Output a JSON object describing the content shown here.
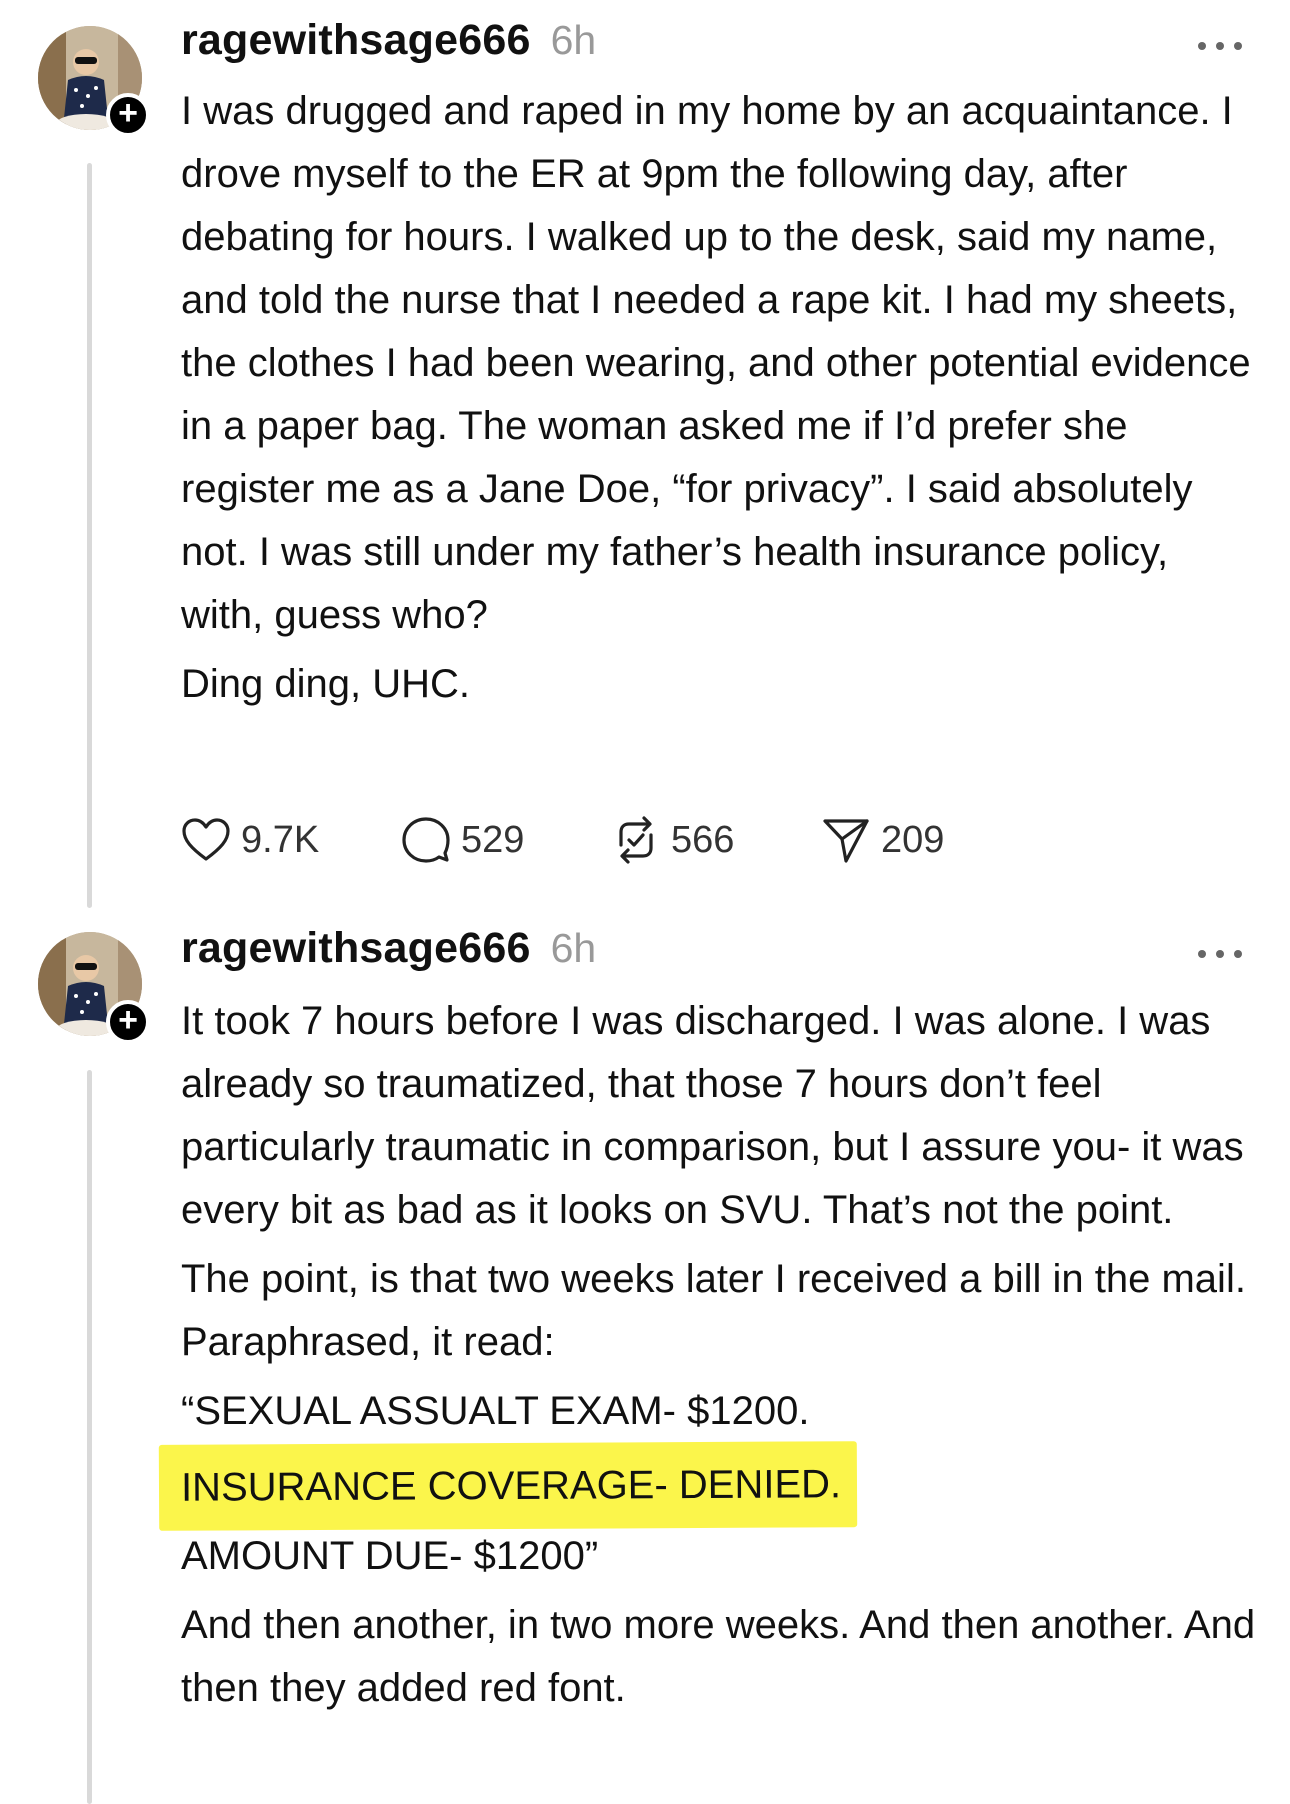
{
  "posts": [
    {
      "username": "ragewithsage666",
      "time": "6h",
      "paragraphs": [
        "I was drugged and raped in my home by an acquaintance. I drove myself to the ER at 9pm the following day, after debating for hours. I walked up to the desk, said my name, and told the nurse that I needed a rape kit. I had my sheets, the clothes I had been wearing, and other potential evidence in a paper bag. The woman asked me if I’d prefer she register me as a Jane Doe, “for privacy”. I said absolutely not. I was still under my father’s health insurance policy, with, guess who?",
        "Ding ding, UHC."
      ],
      "stats": {
        "likes": "9.7K",
        "replies": "529",
        "reposts": "566",
        "shares": "209"
      }
    },
    {
      "username": "ragewithsage666",
      "time": "6h",
      "paragraphs": [
        "It took 7 hours before I was discharged. I was alone. I was already so traumatized, that those 7 hours don’t feel particularly traumatic in comparison, but I assure you- it was every bit as bad as it looks on SVU. That’s not the point.",
        "The point, is that two weeks later I received a bill in the mail. Paraphrased, it read:",
        "“SEXUAL ASSUALT EXAM- $1200.",
        "INSURANCE COVERAGE- DENIED.",
        "AMOUNT DUE- $1200”",
        "And then another, in two more weeks. And then another. And then they added red font."
      ]
    }
  ],
  "icons": {
    "more": "more-horizontal-icon",
    "like": "heart-icon",
    "reply": "comment-bubble-icon",
    "repost": "repost-icon",
    "share": "send-icon",
    "follow": "plus-icon"
  },
  "colors": {
    "highlight": "#fbf54b",
    "muted_text": "#999999",
    "thread_line": "#d9d9d9"
  }
}
